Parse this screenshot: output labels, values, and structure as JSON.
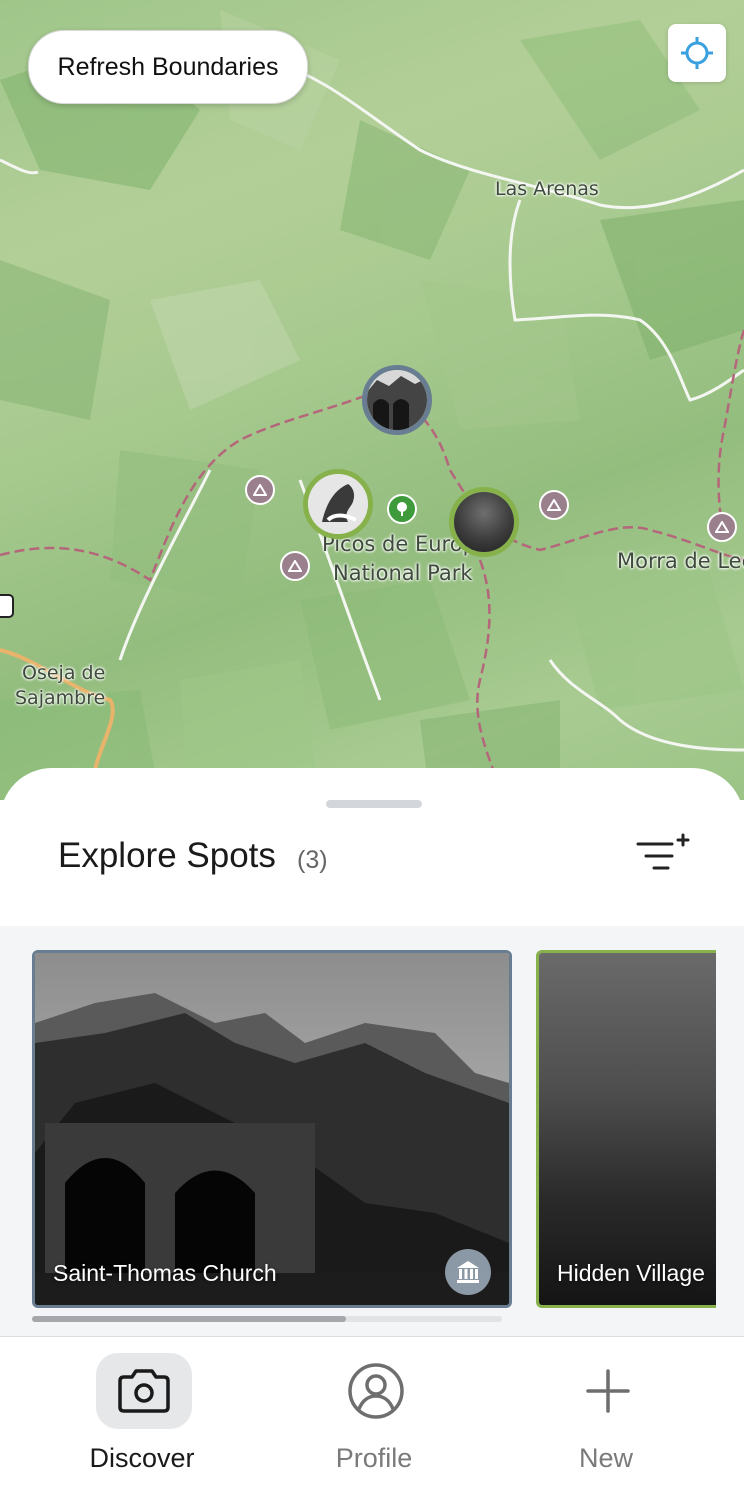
{
  "map": {
    "refresh_label": "Refresh Boundaries",
    "locate_icon": "crosshair-icon",
    "labels": {
      "las_arenas": "Las Arenas",
      "park_line1": "Picos de Europ",
      "park_line2": "National Park",
      "morra": "Morra de Lec",
      "oseja_line1": "Oseja de",
      "oseja_line2": "Sajambre"
    },
    "colors": {
      "marker_church": "#687d91",
      "marker_horse": "#86b14b",
      "marker_village": "#86b14b",
      "poi_mountain": "#9a7f8d",
      "poi_park": "#3e9a3a"
    }
  },
  "sheet": {
    "title": "Explore Spots",
    "count": "(3)",
    "filter_icon": "filter-add-icon"
  },
  "cards": [
    {
      "label": "Saint-Thomas Church",
      "category_icon": "landmark-icon",
      "border_color": "#687d91"
    },
    {
      "label": "Hidden Village",
      "border_color": "#86b14b"
    }
  ],
  "nav": {
    "discover": "Discover",
    "profile": "Profile",
    "new": "New",
    "active": "discover"
  }
}
